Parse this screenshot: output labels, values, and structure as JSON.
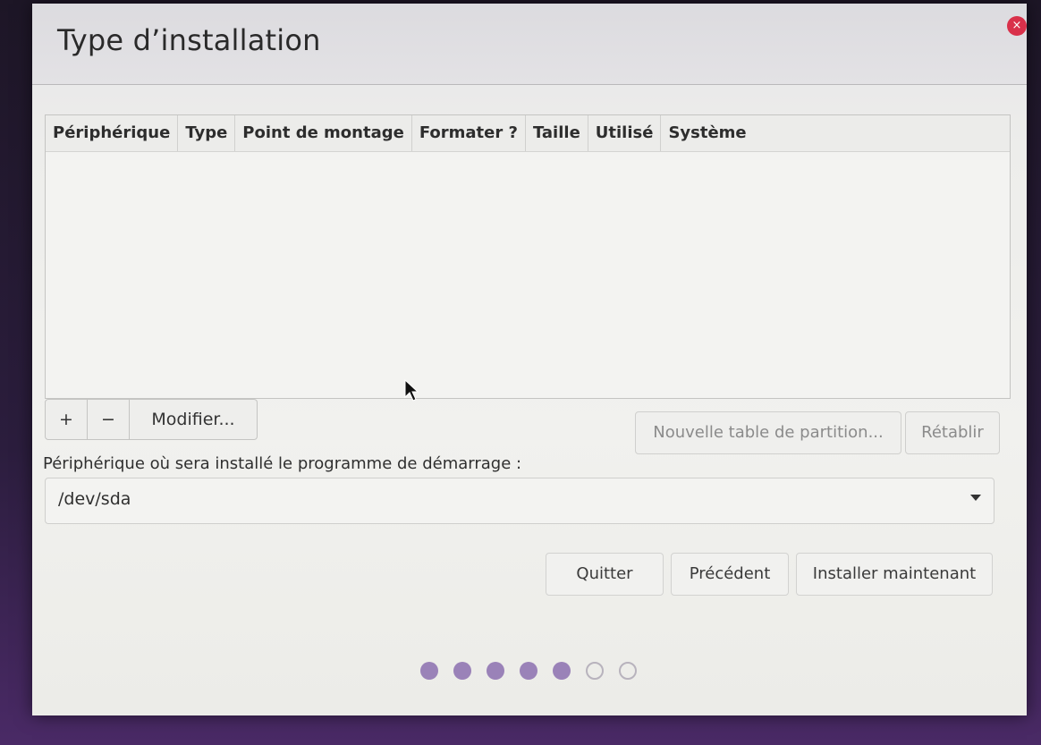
{
  "window": {
    "title": "Type d’installation",
    "close_glyph": "×"
  },
  "table": {
    "columns": [
      "Périphérique",
      "Type",
      "Point de montage",
      "Formater ?",
      "Taille",
      "Utilisé",
      "Système"
    ],
    "rows": []
  },
  "partition_buttons": {
    "add": "+",
    "remove": "−",
    "modify": "Modifier..."
  },
  "table_buttons": {
    "new_table": "Nouvelle table de partition...",
    "reset": "Rétablir"
  },
  "bootloader": {
    "label": "Périphérique où sera installé le programme de démarrage :",
    "selected": "/dev/sda"
  },
  "nav": {
    "quit": "Quitter",
    "previous": "Précédent",
    "install": "Installer maintenant"
  },
  "progress": {
    "total_steps": 7,
    "completed_steps": 5
  },
  "colors": {
    "accent": "#9a82b8",
    "close": "#d9304a"
  },
  "icons": [
    "close-icon",
    "combo-arrow-icon",
    "mouse-cursor-icon"
  ]
}
